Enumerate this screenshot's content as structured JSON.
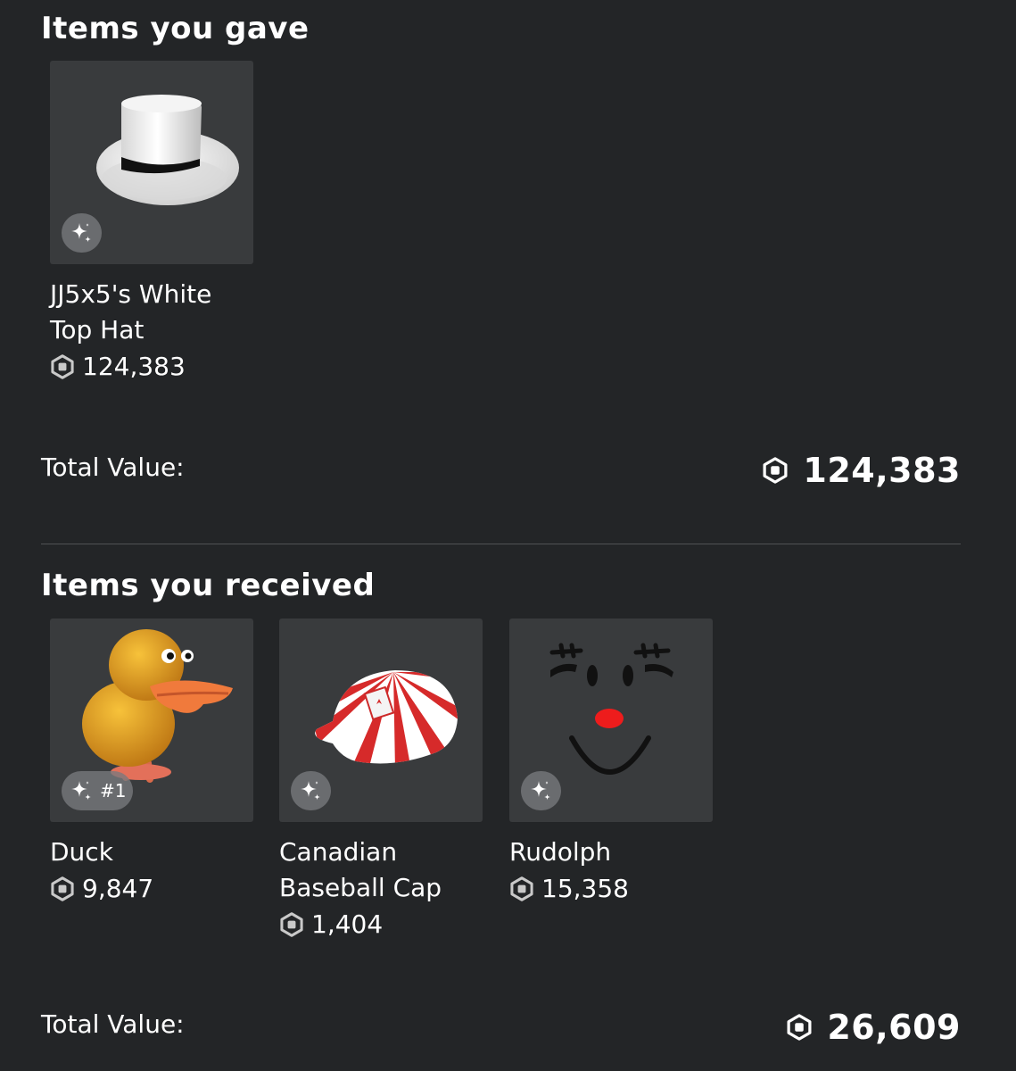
{
  "gave": {
    "title": "Items you gave",
    "items": [
      {
        "name": "JJ5x5's White Top Hat",
        "price": "124,383",
        "icon": "white-top-hat-icon",
        "serial": ""
      }
    ],
    "total_label": "Total Value:",
    "total_value": "124,383"
  },
  "received": {
    "title": "Items you received",
    "items": [
      {
        "name": "Duck",
        "price": "9,847",
        "icon": "duck-icon",
        "serial": "#1"
      },
      {
        "name": "Canadian Baseball Cap",
        "price": "1,404",
        "icon": "baseball-cap-icon",
        "serial": ""
      },
      {
        "name": "Rudolph",
        "price": "15,358",
        "icon": "rudolph-face-icon",
        "serial": ""
      }
    ],
    "total_label": "Total Value:",
    "total_value": "26,609"
  },
  "colors": {
    "background": "#232527",
    "tile": "#393b3d",
    "divider": "#4f5154",
    "text": "#ffffff"
  },
  "icons": {
    "currency": "robux-icon",
    "limited": "sparkle-icon"
  }
}
